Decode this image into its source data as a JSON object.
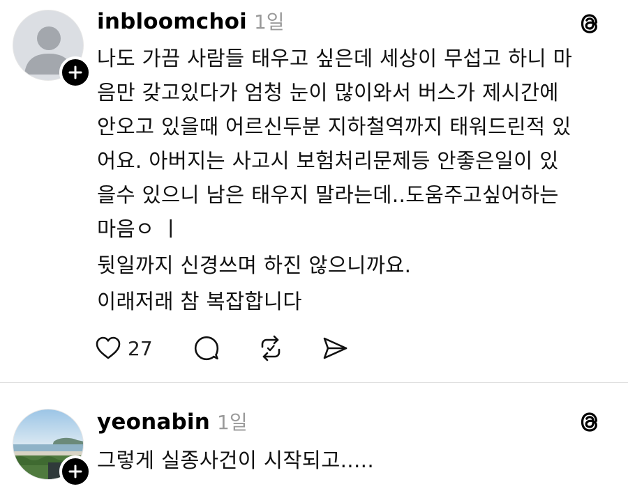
{
  "posts": [
    {
      "username": "inbloomchoi",
      "timestamp": "1일",
      "avatar": "default-avatar-icon",
      "lines": [
        "나도 가끔 사람들 태우고 싶은데 세상이 무섭고 하니 마",
        "음만 갖고있다가 엄청 눈이 많이와서 버스가 제시간에",
        "안오고 있을때 어르신두분 지하철역까지 태워드린적 있",
        "어요. 아버지는 사고시 보험처리문제등 안좋은일이 있",
        "을수 있으니 남은 태우지 말라는데..도움주고싶어하는",
        "마음ㅇ ㅣ",
        "뒷일까지 신경쓰며 하진 않으니까요.",
        "이래저래 참 복잡합니다"
      ],
      "actions": {
        "like_icon": "heart-icon",
        "like_count": "27",
        "reply_icon": "comment-icon",
        "repost_icon": "repost-icon",
        "share_icon": "send-icon"
      }
    },
    {
      "username": "yeonabin",
      "timestamp": "1일",
      "avatar": "beach-photo-avatar",
      "lines": [
        "그렇게 실종사건이 시작되고....."
      ]
    }
  ],
  "icons": {
    "brand": "threads-logo-icon",
    "follow": "plus-badge-icon"
  },
  "colors": {
    "text": "#000000",
    "muted": "#9a9a9a",
    "divider": "#dadada",
    "badge": "#000000"
  }
}
